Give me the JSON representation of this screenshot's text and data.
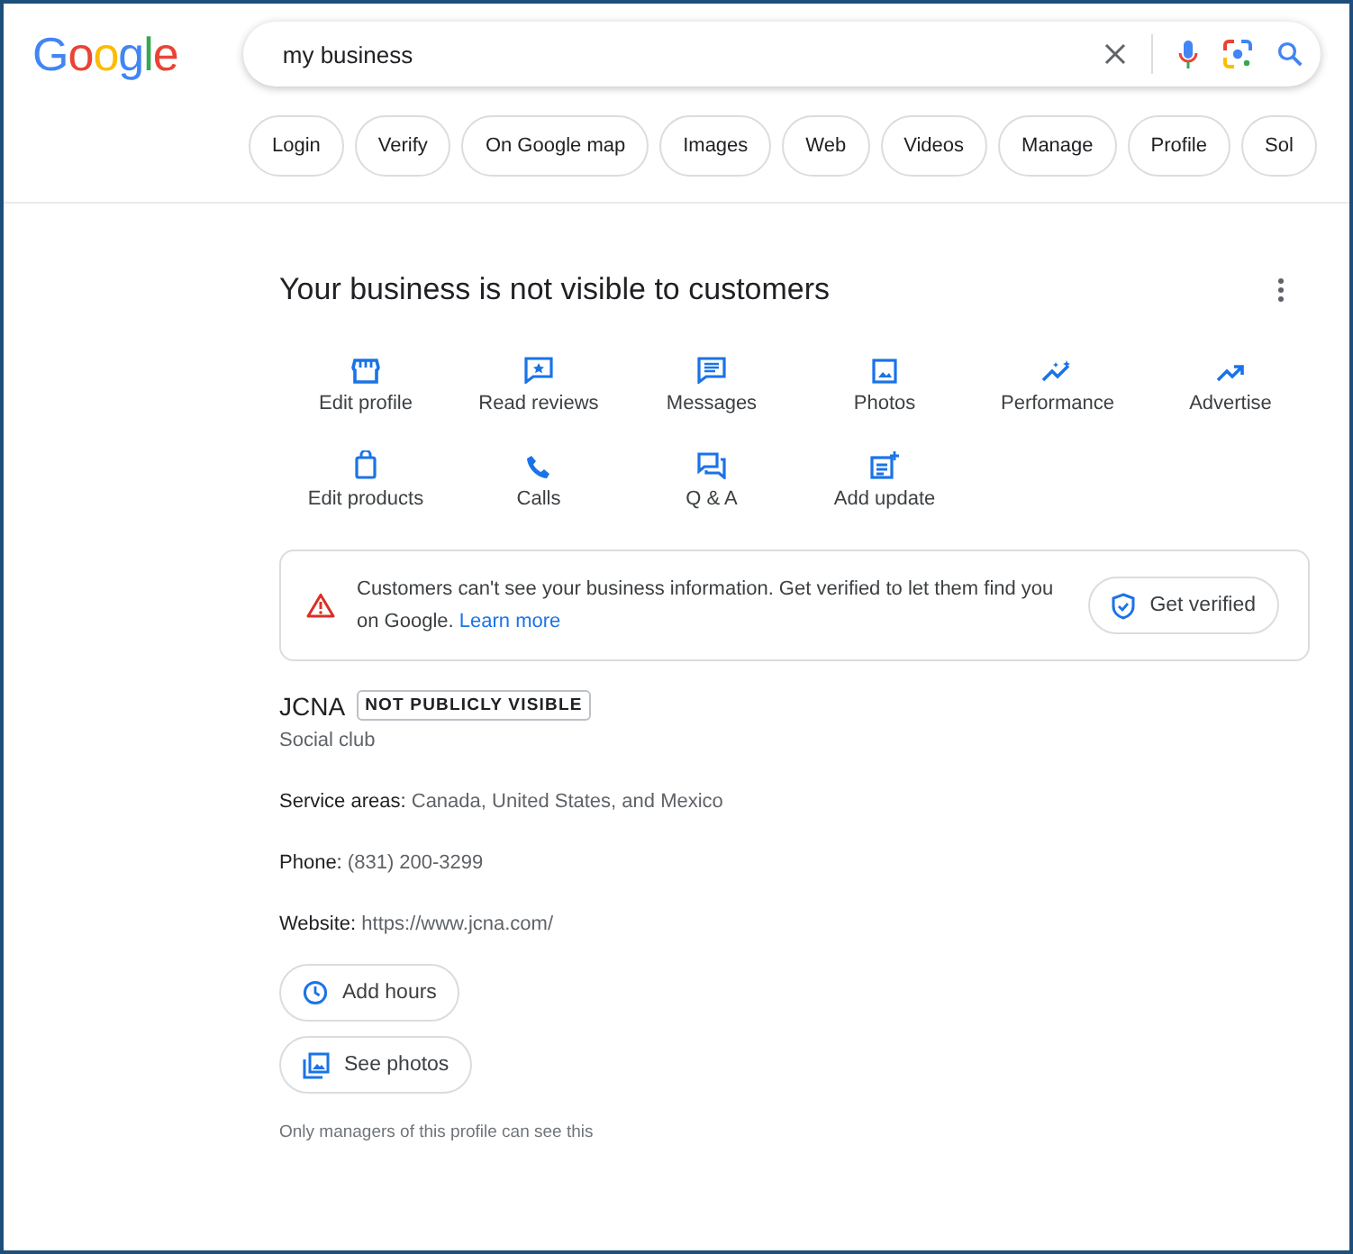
{
  "logo": "Google",
  "search": {
    "value": "my business"
  },
  "chips": [
    {
      "label": "Login"
    },
    {
      "label": "Verify"
    },
    {
      "label": "On Google map"
    },
    {
      "label": "Images"
    },
    {
      "label": "Web"
    },
    {
      "label": "Videos"
    },
    {
      "label": "Manage"
    },
    {
      "label": "Profile"
    },
    {
      "label": "Sol"
    }
  ],
  "panel": {
    "title": "Your business is not visible to customers",
    "actions": [
      {
        "label": "Edit profile"
      },
      {
        "label": "Read reviews"
      },
      {
        "label": "Messages"
      },
      {
        "label": "Photos"
      },
      {
        "label": "Performance"
      },
      {
        "label": "Advertise"
      },
      {
        "label": "Edit products"
      },
      {
        "label": "Calls"
      },
      {
        "label": "Q & A"
      },
      {
        "label": "Add update"
      }
    ],
    "alert": {
      "text": "Customers can't see your business information. Get verified to let them find you on Google.",
      "link": "Learn more",
      "button": "Get verified"
    },
    "business": {
      "name": "JCNA",
      "badge": "NOT PUBLICLY VISIBLE",
      "category": "Social club"
    },
    "details": [
      "**Service areas:** Canada, United States, and Mexico",
      "**Phone:** (831) 200-3299",
      "**Website:** https://www.jcna.com/"
    ],
    "buttons": [
      {
        "label": "Add hours"
      },
      {
        "label": "See photos"
      }
    ],
    "footnote": "Only managers of this profile can see this"
  }
}
